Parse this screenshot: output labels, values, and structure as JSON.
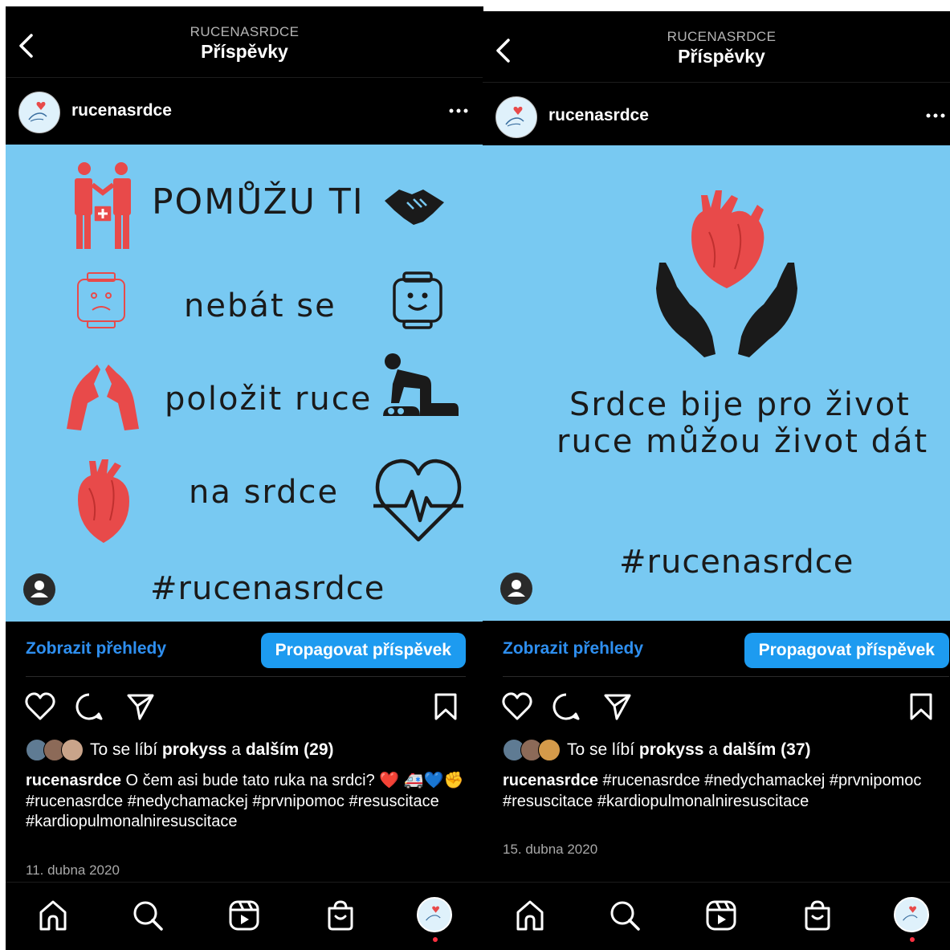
{
  "colors": {
    "background": "#000000",
    "post_image_bg": "#78c9f2",
    "link_blue": "#2e8ff0",
    "promote_button": "#1d9bf0",
    "heart_red": "#e84a4a",
    "notification_dot": "#ff3040"
  },
  "posts": [
    {
      "header": {
        "account_caps": "RUCENASRDCE",
        "title": "Příspěvky"
      },
      "username": "rucenasrdce",
      "image_text": {
        "line1": "POMŮŽU TI",
        "line2": "nebát se",
        "line3": "položit ruce",
        "line4": "na srdce",
        "hashtag": "#rucenasrdce"
      },
      "image_icons": [
        "medic-helping-icon",
        "handshake-icon",
        "sad-face-icon",
        "smile-face-icon",
        "hands-icon",
        "cpr-icon",
        "anatomical-heart-icon",
        "heartbeat-icon"
      ],
      "insights_label": "Zobrazit přehledy",
      "promote_label": "Propagovat příspěvek",
      "likes": {
        "prefix": "To se líbí",
        "user": "prokyss",
        "joiner": "a",
        "rest": "dalším (29)"
      },
      "caption": {
        "user": "rucenasrdce",
        "text": "O čem asi bude tato ruka na srdci? ❤️ 🚑💙✊ #rucenasrdce #nedychamackej #prvnipomoc #resuscitace #kardiopulmonalniresuscitace"
      },
      "date": "11. dubna 2020"
    },
    {
      "header": {
        "account_caps": "RUCENASRDCE",
        "title": "Příspěvky"
      },
      "username": "rucenasrdce",
      "image_text": {
        "line1": "Srdce bije pro život",
        "line2": "ruce můžou život dát",
        "hashtag": "#rucenasrdce"
      },
      "image_icons": [
        "heart-in-hands-icon"
      ],
      "insights_label": "Zobrazit přehledy",
      "promote_label": "Propagovat příspěvek",
      "likes": {
        "prefix": "To se líbí",
        "user": "prokyss",
        "joiner": "a",
        "rest": "dalším (37)"
      },
      "caption": {
        "user": "rucenasrdce",
        "text": "#rucenasrdce #nedychamackej #prvnipomoc #resuscitace #kardiopulmonalniresuscitace"
      },
      "date": "15. dubna 2020"
    }
  ],
  "nav_icons": [
    "home-icon",
    "search-icon",
    "reels-icon",
    "shop-icon",
    "profile-avatar"
  ]
}
